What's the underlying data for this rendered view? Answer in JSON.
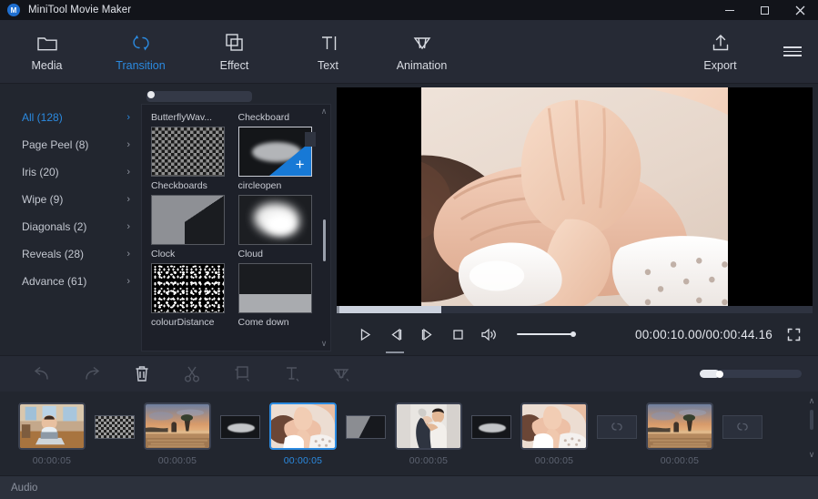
{
  "window": {
    "title": "MiniTool Movie Maker",
    "logo_letter": "M",
    "controls": {
      "minimize": "minimize-icon",
      "maximize": "maximize-icon",
      "close": "×"
    }
  },
  "toolbar": {
    "items": [
      {
        "label": "Media",
        "icon": "folder-icon",
        "active": false
      },
      {
        "label": "Transition",
        "icon": "transition-arrows-icon",
        "active": true
      },
      {
        "label": "Effect",
        "icon": "layers-icon",
        "active": false
      },
      {
        "label": "Text",
        "icon": "text-cursor-icon",
        "active": false
      },
      {
        "label": "Animation",
        "icon": "diamond-icon",
        "active": false
      },
      {
        "label": "Export",
        "icon": "upload-icon",
        "active": false
      }
    ],
    "menu": "hamburger-menu-icon"
  },
  "library": {
    "categories": [
      {
        "label": "All (128)",
        "selected": true
      },
      {
        "label": "Page Peel (8)",
        "selected": false
      },
      {
        "label": "Iris (20)",
        "selected": false
      },
      {
        "label": "Wipe (9)",
        "selected": false
      },
      {
        "label": "Diagonals (2)",
        "selected": false
      },
      {
        "label": "Reveals (28)",
        "selected": false
      },
      {
        "label": "Advance (61)",
        "selected": false
      }
    ],
    "chevron": "›",
    "top_labels": [
      "ButterflyWav...",
      "Checkboard"
    ],
    "transitions": [
      {
        "name": "Checkboards",
        "style": "checker",
        "hovered": false
      },
      {
        "name": "circleopen",
        "style": "circleopen",
        "hovered": true
      },
      {
        "name": "Clock",
        "style": "clock",
        "hovered": false
      },
      {
        "name": "Cloud",
        "style": "cloud",
        "hovered": false
      },
      {
        "name": "colourDistance",
        "style": "noise",
        "hovered": false
      },
      {
        "name": "Come down",
        "style": "comedown",
        "hovered": false
      }
    ],
    "add_badge": "+",
    "scroll_up": "∧",
    "scroll_down": "∨"
  },
  "player": {
    "controls": [
      {
        "name": "play-button",
        "icon": "play-icon"
      },
      {
        "name": "previous-frame-button",
        "icon": "prev-frame-icon"
      },
      {
        "name": "next-frame-button",
        "icon": "next-frame-icon"
      },
      {
        "name": "stop-button",
        "icon": "stop-icon"
      },
      {
        "name": "volume-button",
        "icon": "speaker-icon"
      }
    ],
    "current_time": "00:00:10.00",
    "total_time": "00:00:44.16",
    "timecode": "00:00:10.00/00:00:44.16",
    "fullscreen": "fullscreen-icon",
    "progress_percent": 22,
    "volume_percent": 100
  },
  "edit_toolbar": {
    "items": [
      {
        "name": "undo-button",
        "icon": "undo-icon",
        "enabled": false
      },
      {
        "name": "redo-button",
        "icon": "redo-icon",
        "enabled": false
      },
      {
        "name": "delete-button",
        "icon": "trash-icon",
        "enabled": true
      },
      {
        "name": "split-button",
        "icon": "scissors-icon",
        "enabled": false
      },
      {
        "name": "crop-button",
        "icon": "crop-icon",
        "enabled": false
      },
      {
        "name": "text-button",
        "icon": "text-icon",
        "enabled": false
      },
      {
        "name": "effect-button",
        "icon": "diamond-icon",
        "enabled": false
      }
    ],
    "zoom_percent": 16
  },
  "timeline": {
    "clips": [
      {
        "duration": "00:00:05",
        "selected": false,
        "thumb": "man-at-laptop"
      },
      {
        "duration": "00:00:05",
        "selected": false,
        "thumb": "beach-sunset"
      },
      {
        "duration": "00:00:05",
        "selected": true,
        "thumb": "baby-hand"
      },
      {
        "duration": "00:00:05",
        "selected": false,
        "thumb": "couple-dancing"
      },
      {
        "duration": "00:00:05",
        "selected": false,
        "thumb": "baby-hand-2"
      },
      {
        "duration": "00:00:05",
        "selected": false,
        "thumb": "beach-sunset-2"
      }
    ],
    "transition_slots": [
      {
        "style": "checker",
        "empty": false
      },
      {
        "style": "ellipse",
        "empty": false
      },
      {
        "style": "clockw",
        "empty": false
      },
      {
        "style": "ellipse",
        "empty": false
      },
      {
        "style": "empty",
        "empty": true
      },
      {
        "style": "empty",
        "empty": true
      }
    ],
    "scroll_up": "∧",
    "scroll_down": "∨"
  },
  "audio_track": {
    "label": "Audio"
  },
  "colors": {
    "accent": "#2b8ae0",
    "titlebar_bg": "#12141a",
    "toolbar_bg": "#262a35",
    "panel_bg": "#22262f",
    "grid_bg": "#1d2029",
    "text": "#d6d9e0",
    "muted_text": "#5d6371"
  }
}
